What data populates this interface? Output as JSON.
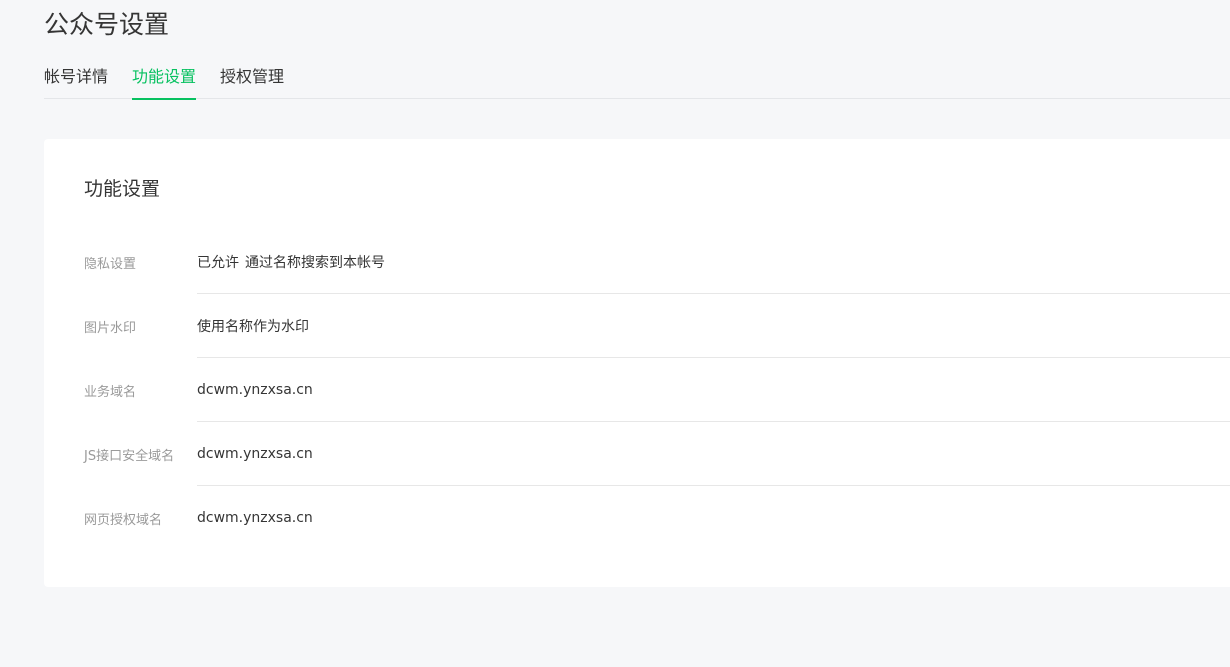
{
  "header": {
    "title": "公众号设置"
  },
  "tabs": [
    {
      "label": "帐号详情",
      "active": false
    },
    {
      "label": "功能设置",
      "active": true
    },
    {
      "label": "授权管理",
      "active": false
    }
  ],
  "colors": {
    "accent": "#07c160",
    "background": "#f6f7f9"
  },
  "section": {
    "title": "功能设置",
    "rows": [
      {
        "label": "隐私设置",
        "status": "已允许",
        "value": "通过名称搜索到本帐号"
      },
      {
        "label": "图片水印",
        "value": "使用名称作为水印"
      },
      {
        "label": "业务域名",
        "value": "dcwm.ynzxsa.cn"
      },
      {
        "label": "JS接口安全域名",
        "value": "dcwm.ynzxsa.cn"
      },
      {
        "label": "网页授权域名",
        "value": "dcwm.ynzxsa.cn"
      }
    ]
  }
}
